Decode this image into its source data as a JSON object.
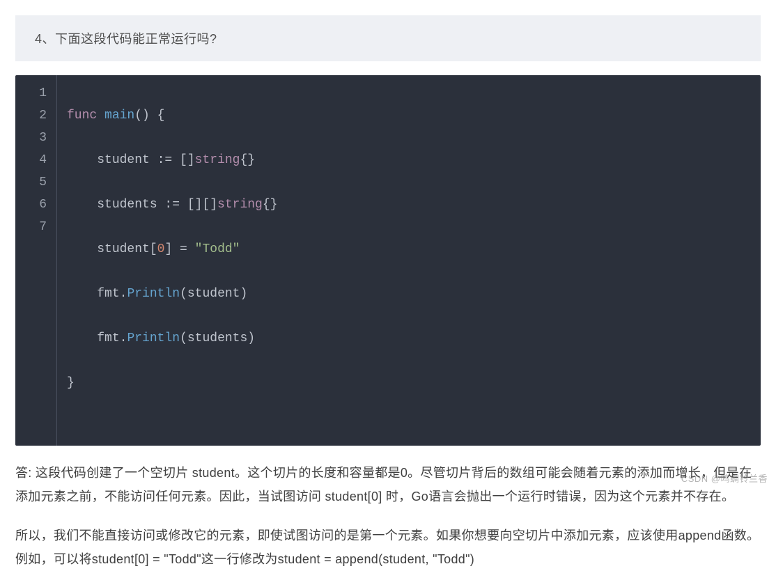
{
  "question": "4、下面这段代码能正常运行吗?",
  "code": {
    "line_numbers": [
      "1",
      "2",
      "3",
      "4",
      "5",
      "6",
      "7"
    ],
    "l1": {
      "func": "func",
      "main": "main",
      "rest": "() {"
    },
    "l2": {
      "indent": "    ",
      "a": "student := []",
      "string": "string",
      "b": "{}"
    },
    "l3": {
      "indent": "    ",
      "a": "students := [][]",
      "string": "string",
      "b": "{}"
    },
    "l4": {
      "indent": "    ",
      "a": "student[",
      "zero": "0",
      "b": "] = ",
      "s": "\"Todd\""
    },
    "l5": {
      "indent": "    ",
      "a": "fmt.",
      "fn": "Println",
      "b": "(student)"
    },
    "l6": {
      "indent": "    ",
      "a": "fmt.",
      "fn": "Println",
      "b": "(students)"
    },
    "l7": {
      "a": "}"
    }
  },
  "answer_p1": "答:  这段代码创建了一个空切片 student。这个切片的长度和容量都是0。尽管切片背后的数组可能会随着元素的添加而增长，但是在添加元素之前，不能访问任何元素。因此，当试图访问 student[0] 时，Go语言会抛出一个运行时错误，因为这个元素并不存在。",
  "answer_p2": "所以，我们不能直接访问或修改它的元素，即使试图访问的是第一个元素。如果你想要向空切片中添加元素，应该使用append函数。例如，可以将student[0] = \"Todd\"这一行修改为student = append(student, \"Todd\")",
  "watermark": "CSDN @鸣蜩铃兰香"
}
